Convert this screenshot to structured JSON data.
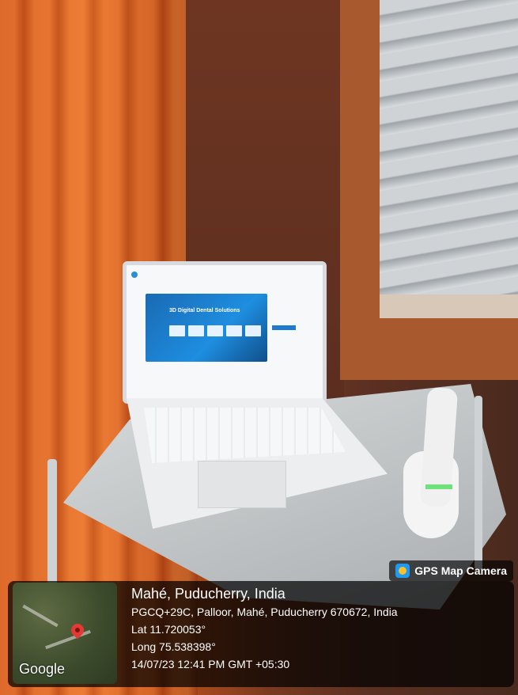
{
  "photo": {
    "subject": "laptop-and-intraoral-scanner-on-cart",
    "screen_heading": "3D Digital Dental Solutions"
  },
  "watermark": {
    "app_name": "GPS Map Camera",
    "map_brand": "Google",
    "place_title": "Mahé, Puducherry, India",
    "address": "PGCQ+29C, Palloor, Mahé, Puducherry 670672, India",
    "lat": "Lat 11.720053°",
    "long": "Long 75.538398°",
    "timestamp": "14/07/23 12:41 PM GMT +05:30"
  }
}
